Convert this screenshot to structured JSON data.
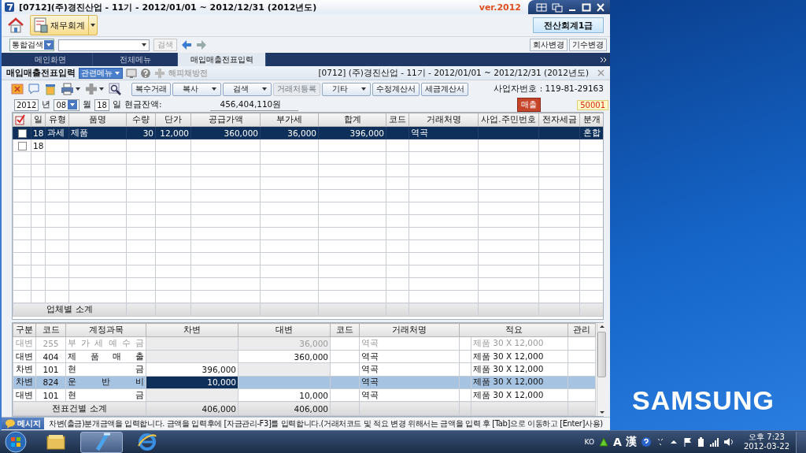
{
  "window": {
    "title": "[0712](주)경진산업 - 11기 - 2012/01/01 ~ 2012/12/31 (2012년도)",
    "version": "ver.2012"
  },
  "toolbar": {
    "module": "재무회계",
    "license": "전산회계1급"
  },
  "search_bar": {
    "scope": "통합검색",
    "search_button": "검색",
    "buttons": [
      "회사변경",
      "기수변경"
    ]
  },
  "tabs": [
    {
      "label": "메인화면",
      "selected": false
    },
    {
      "label": "전체메뉴",
      "selected": false
    },
    {
      "label": "매입매출전표입력",
      "selected": true
    }
  ],
  "screen_header": {
    "title": "매입매출전표입력",
    "menu": "관련메뉴",
    "disabled_action": "해피채방전",
    "info": "[0712] (주)경진산업 - 11기 - 2012/01/01 ~ 2012/12/31 (2012년도)"
  },
  "actions": [
    {
      "label": "복수거래",
      "dropdown": false,
      "disabled": false
    },
    {
      "label": "복사",
      "dropdown": true,
      "disabled": false
    },
    {
      "label": "검색",
      "dropdown": true,
      "disabled": false
    },
    {
      "label": "거래처등록",
      "dropdown": false,
      "disabled": true
    },
    {
      "label": "기타",
      "dropdown": true,
      "disabled": false
    },
    {
      "label": "수정계산서",
      "dropdown": false,
      "disabled": false
    },
    {
      "label": "세금계산서",
      "dropdown": false,
      "disabled": false
    }
  ],
  "business_number": "사업자번호 : 119-81-29163",
  "date_bar": {
    "year": "2012",
    "year_unit": "년",
    "month": "08",
    "month_unit": "월",
    "day": "18",
    "day_unit": "일",
    "balance_label": "현금잔액:",
    "balance": "456,404,110원",
    "type_badge": "매출",
    "voucher_no": "50001"
  },
  "sales_grid": {
    "columns": [
      "일",
      "유형",
      "품명",
      "수량",
      "단가",
      "공급가액",
      "부가세",
      "합계",
      "코드",
      "거래처명",
      "사업.주민번호",
      "전자세금",
      "분개"
    ],
    "rows": [
      {
        "checked": false,
        "selected": true,
        "day": "18",
        "type": "과세",
        "item": "제품",
        "qty": "30",
        "price": "12,000",
        "supply": "360,000",
        "vat": "36,000",
        "total": "396,000",
        "partner": "역곡",
        "entry": "혼합"
      },
      {
        "checked": false,
        "selected": false,
        "day": "18"
      }
    ],
    "footer": "업체별 소계"
  },
  "journal": {
    "columns": [
      "구분",
      "코드",
      "계정과목",
      "차변",
      "대변",
      "코드",
      "거래처명",
      "적요",
      "관리"
    ],
    "rows": [
      {
        "kind": "credit",
        "disabled": true,
        "selected": false,
        "side": "대변",
        "code": "255",
        "account": "부 가 세 예 수 금",
        "credit": "36,000",
        "partner": "역곡",
        "memo": "제품 30 X 12,000"
      },
      {
        "kind": "credit",
        "disabled": false,
        "selected": false,
        "side": "대변",
        "code": "404",
        "account": "제 품 매 출",
        "credit": "360,000",
        "partner": "역곡",
        "memo": "제품 30 X 12,000"
      },
      {
        "kind": "debit",
        "disabled": false,
        "selected": false,
        "side": "차변",
        "code": "101",
        "account": "현 금",
        "debit": "396,000",
        "partner": "역곡",
        "memo": "제품 30 X 12,000"
      },
      {
        "kind": "debit",
        "disabled": false,
        "selected": true,
        "side": "차변",
        "code": "824",
        "account": "운 반 비",
        "debit": "10,000",
        "partner": "역곡",
        "memo": "제품 30 X 12,000"
      },
      {
        "kind": "credit",
        "disabled": false,
        "selected": false,
        "side": "대변",
        "code": "101",
        "account": "현 금",
        "credit": "10,000",
        "partner": "역곡",
        "memo": "제품 30 X 12,000"
      }
    ],
    "footer": {
      "label": "전표건별 소계",
      "debit": "406,000",
      "credit": "406,000"
    }
  },
  "message": {
    "label": "메시지",
    "text": "차변(출금)분개금액을 입력합니다. 금액을 입력후에 [자금관리-F3]를 입력합니다.(거래처코드 및 적요 변경 위해서는 금액을 입력 후 [Tab]으로 이동하고 [Enter]사용)"
  },
  "desktop": {
    "wallpaper_text": "SAMSUNG"
  },
  "taskbar": {
    "apps": [
      {
        "kind": "folder",
        "selected": false
      },
      {
        "kind": "app",
        "selected": true
      },
      {
        "kind": "browser",
        "selected": false
      }
    ],
    "language": "KO",
    "ime": "A",
    "ime_hanja": "漢",
    "time": "오후 7:23",
    "date": "2012-03-22"
  }
}
